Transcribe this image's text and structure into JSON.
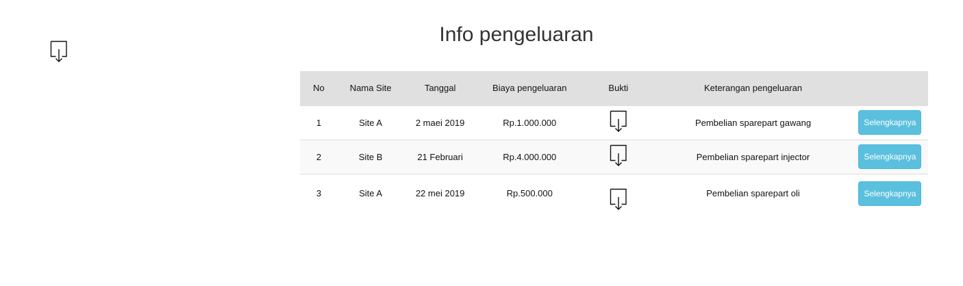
{
  "page": {
    "title": "Info pengeluaran",
    "top_icon": "download-icon"
  },
  "table": {
    "headers": {
      "no": "No",
      "site": "Nama Site",
      "date": "Tanggal",
      "cost": "Biaya pengeluaran",
      "proof": "Bukti",
      "description": "Keterangan pengeluaran",
      "action": ""
    },
    "rows": [
      {
        "no": "1",
        "site": "Site A",
        "date": "2 maei 2019",
        "cost": "Rp.1.000.000",
        "proof_icon": "download-icon",
        "description": "Pembelian sparepart gawang",
        "action_label": "Selengkapnya"
      },
      {
        "no": "2",
        "site": "Site B",
        "date": "21 Februari",
        "cost": "Rp.4.000.000",
        "proof_icon": "download-icon",
        "description": "Pembelian sparepart injector",
        "action_label": "Selengkapnya"
      },
      {
        "no": "3",
        "site": "Site A",
        "date": "22 mei 2019",
        "cost": "Rp.500.000",
        "proof_icon": "download-icon",
        "description": "Pembelian sparepart oli",
        "action_label": "Selengkapnya"
      }
    ]
  },
  "colors": {
    "header_bg": "#e0e0e0",
    "button_bg": "#5bc0de",
    "button_text": "#ffffff",
    "title_text": "#333333"
  }
}
